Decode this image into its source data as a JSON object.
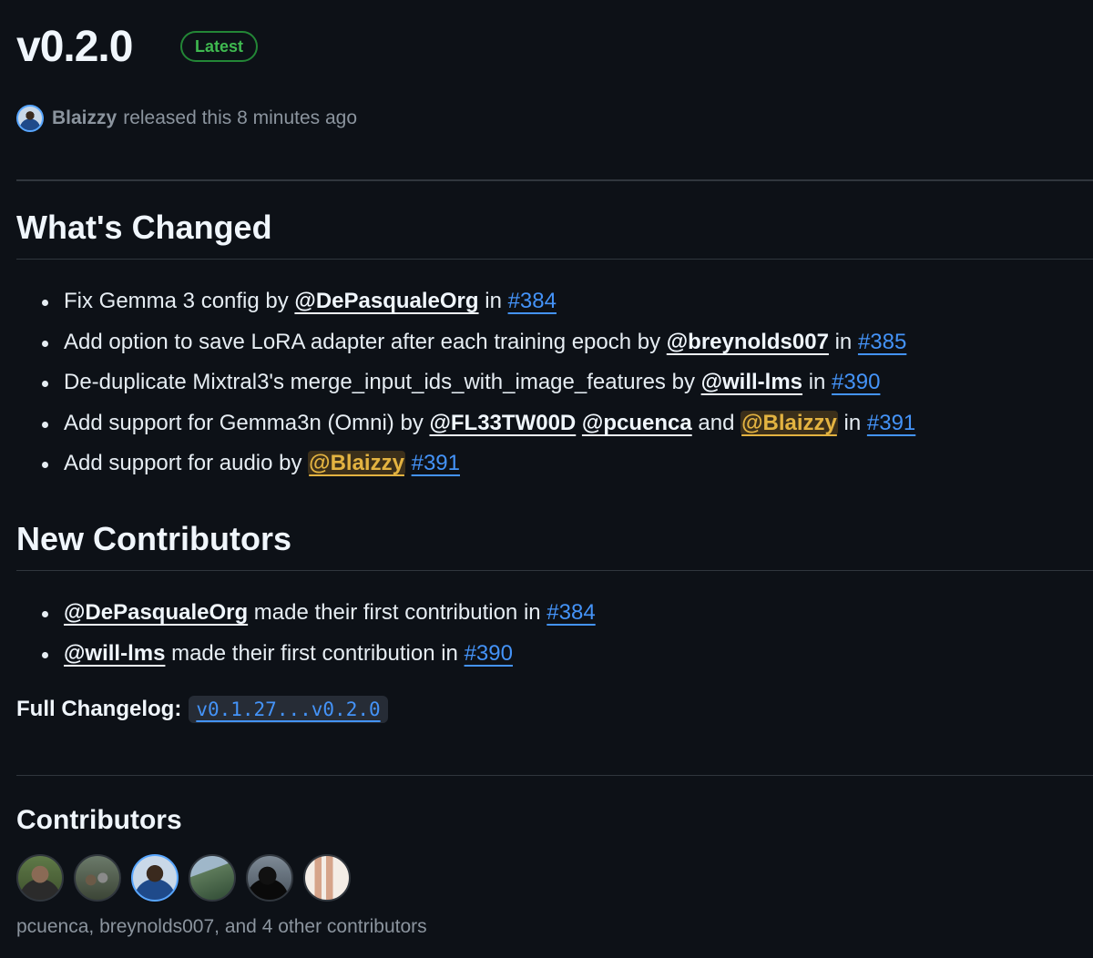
{
  "release": {
    "title": "v0.2.0",
    "badge": "Latest",
    "author": "Blaizzy",
    "meta_text": "released this 8 minutes ago"
  },
  "whats_changed": {
    "heading": "What's Changed",
    "items": [
      {
        "t1": "Fix Gemma 3 config by ",
        "m1": "@DePasqualeOrg",
        "t2": " in ",
        "issue": "#384"
      },
      {
        "t1": "Add option to save LoRA adapter after each training epoch by ",
        "m1": "@breynolds007",
        "t2": " in ",
        "issue": "#385"
      },
      {
        "t1": "De-duplicate Mixtral3's merge_input_ids_with_image_features by ",
        "m1": "@will-lms",
        "t2": " in ",
        "issue": "#390"
      },
      {
        "t1": "Add support for Gemma3n (Omni) by ",
        "m1": "@FL33TW00D",
        "m2": "@pcuenca",
        "t_and": " and ",
        "m3": "@Blaizzy",
        "t2": " in ",
        "issue": "#391"
      },
      {
        "t1": "Add support for audio by ",
        "m1": "@Blaizzy",
        "issue": "#391"
      }
    ]
  },
  "new_contributors": {
    "heading": "New Contributors",
    "items": [
      {
        "mention": "@DePasqualeOrg",
        "text": " made their first contribution in ",
        "issue": "#384"
      },
      {
        "mention": "@will-lms",
        "text": " made their first contribution in ",
        "issue": "#390"
      }
    ]
  },
  "full_changelog": {
    "label": "Full Changelog",
    "colon": ":",
    "range": "v0.1.27...v0.2.0"
  },
  "contributors": {
    "heading": "Contributors",
    "summary": "pcuenca, breynolds007, and 4 other contributors"
  },
  "colors": {
    "background": "#0d1117",
    "link": "#4493f8",
    "badge_green": "#3fb950",
    "self_mention": "#e3b341",
    "muted": "#8b949e"
  }
}
